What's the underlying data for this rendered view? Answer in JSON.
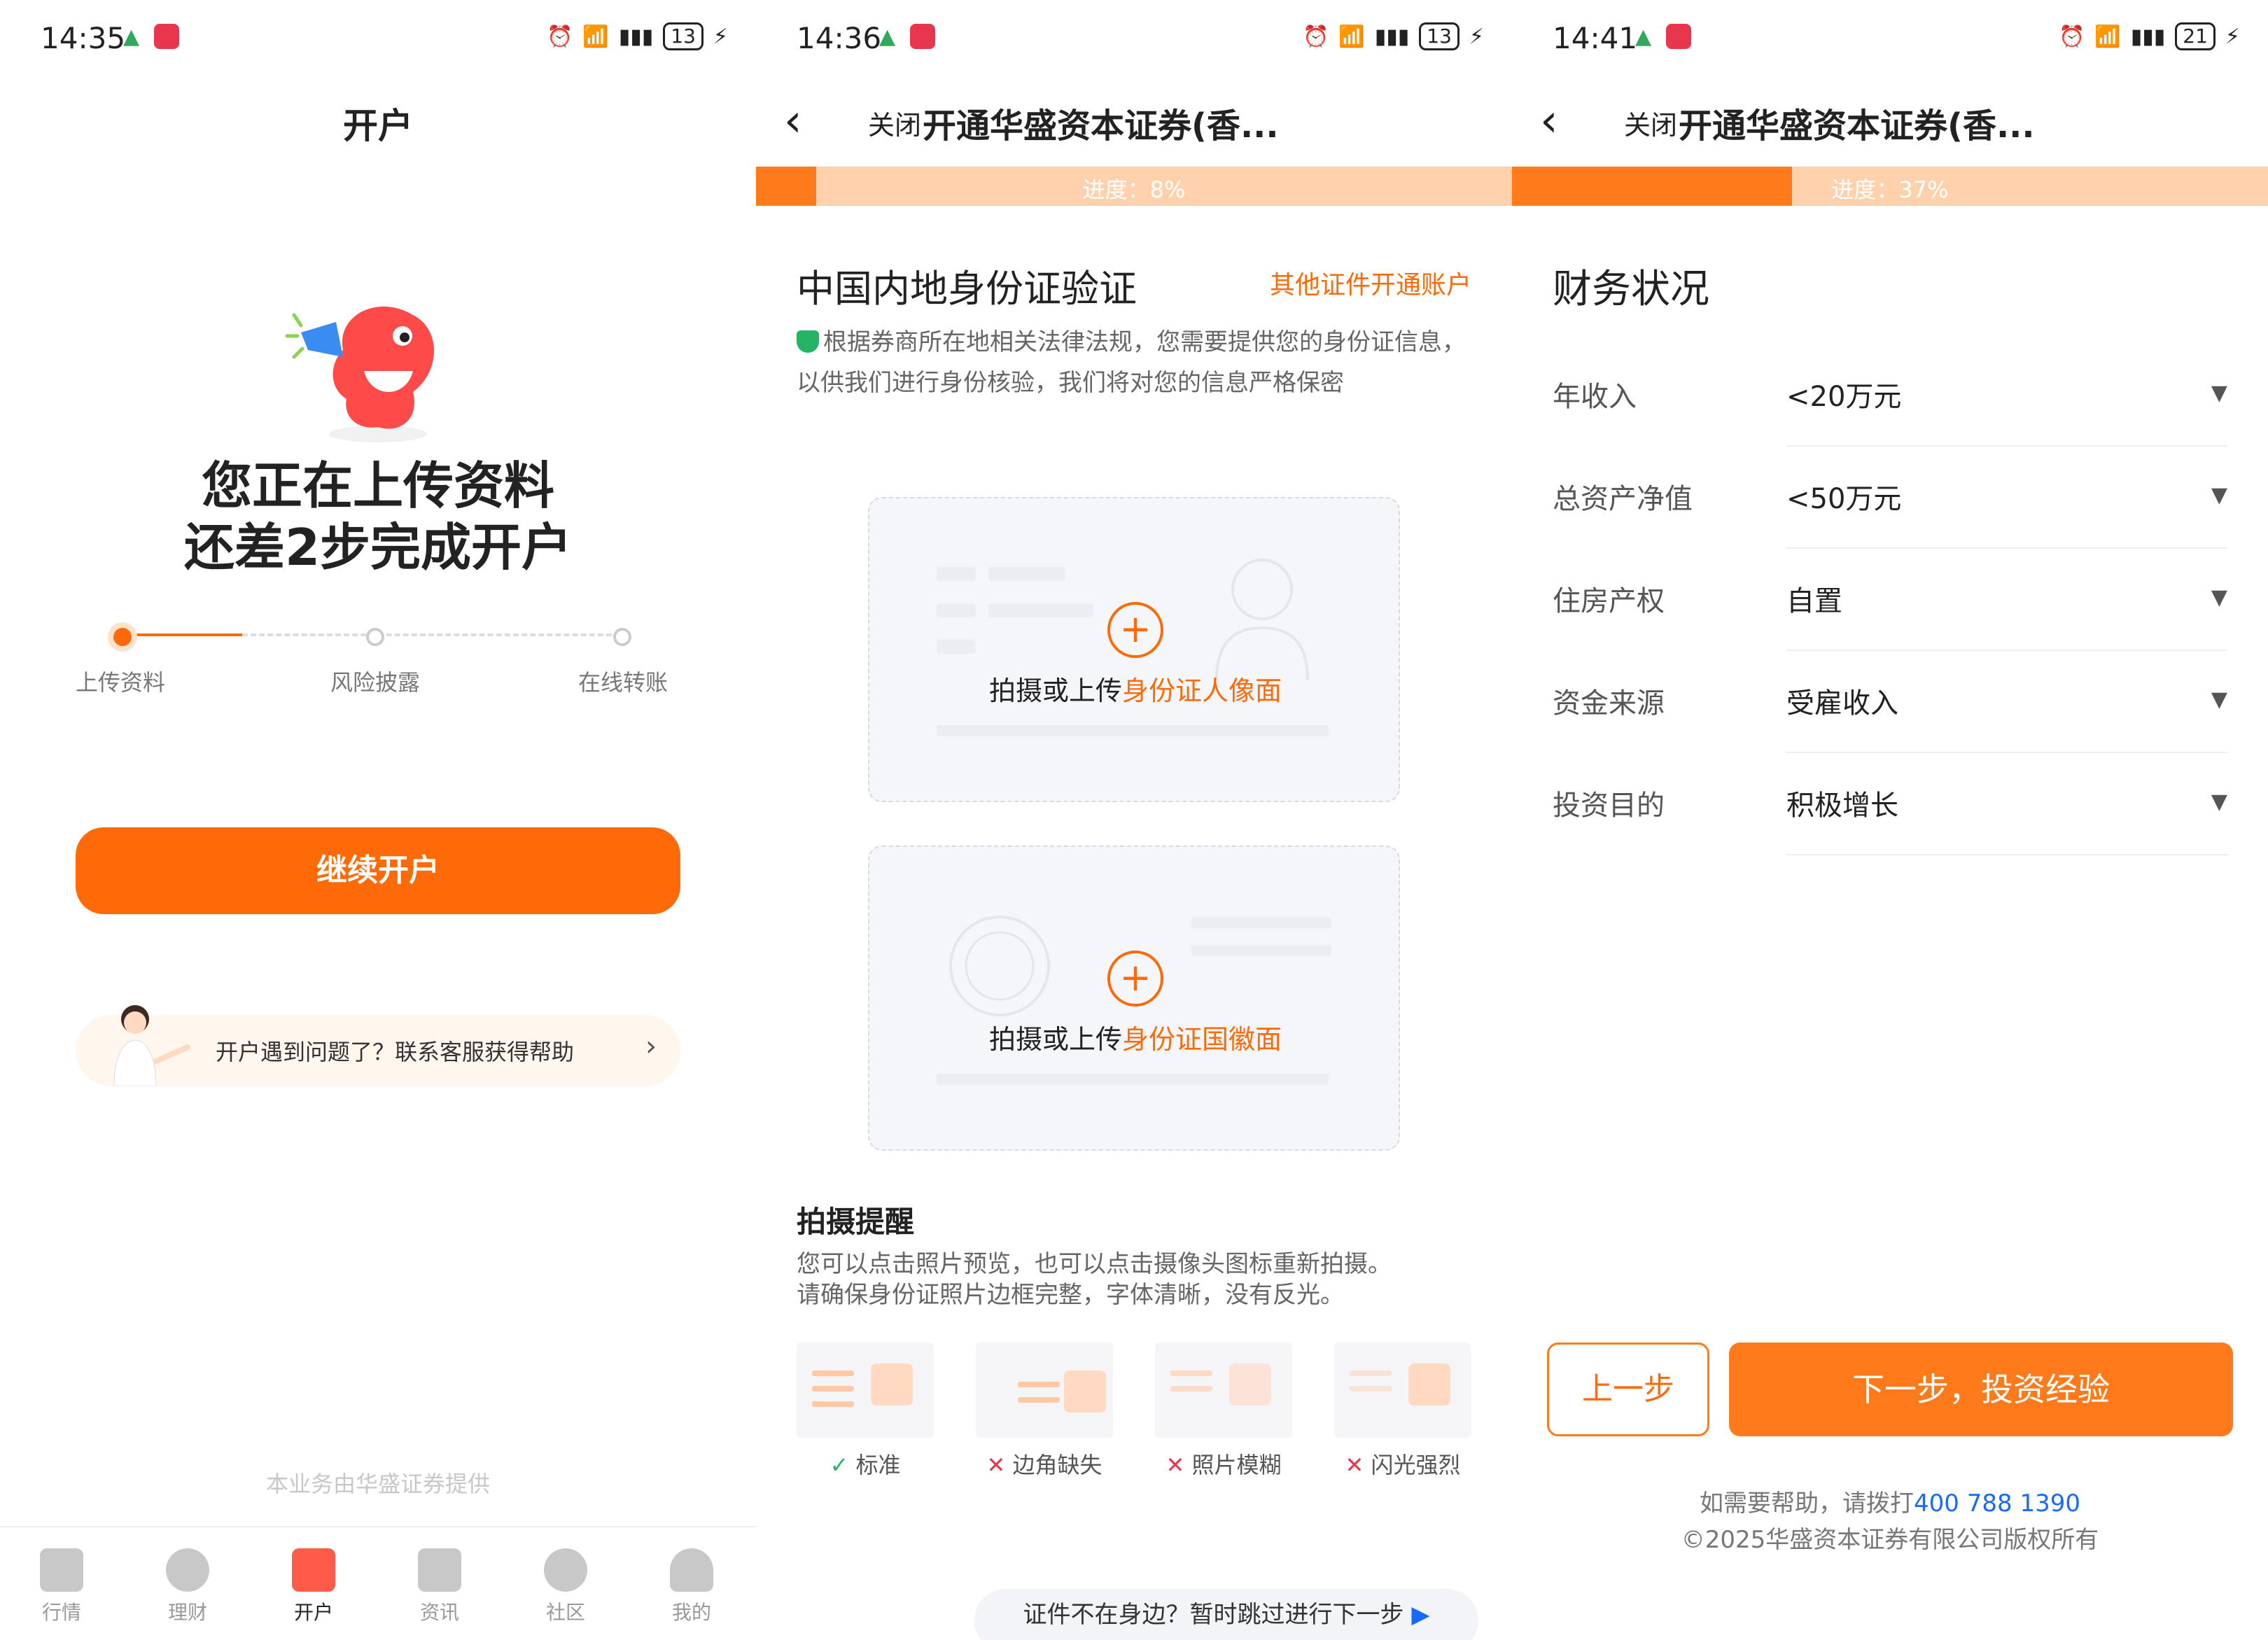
{
  "screen1": {
    "status": {
      "time": "14:35",
      "battery": "13"
    },
    "title": "开户",
    "headline_line1": "您正在上传资料",
    "headline_line2": "还差2步完成开户",
    "steps": [
      "上传资料",
      "风险披露",
      "在线转账"
    ],
    "progress_step": 1,
    "continue_button": "继续开户",
    "help_text": "开户遇到问题了？联系客服获得帮助",
    "provided_by": "本业务由华盛证券提供",
    "tabs": [
      {
        "label": "行情",
        "icon": "chart-icon"
      },
      {
        "label": "理财",
        "icon": "diamond-icon"
      },
      {
        "label": "开户",
        "icon": "gift-icon"
      },
      {
        "label": "资讯",
        "icon": "news-icon"
      },
      {
        "label": "社区",
        "icon": "refresh-icon"
      },
      {
        "label": "我的",
        "icon": "profile-icon"
      }
    ],
    "active_tab": "开户"
  },
  "screen2": {
    "status": {
      "time": "14:36",
      "battery": "13"
    },
    "close": "关闭",
    "title": "开通华盛资本证券(香...",
    "progress_label": "进度：8%",
    "progress_value": 0.08,
    "section_title": "中国内地身份证验证",
    "other_link": "其他证件开通账户",
    "note": "根据券商所在地相关法律法规，您需要提供您的身份证信息，以供我们进行身份核验，我们将对您的信息严格保密",
    "card1_prefix": "拍摄或上传",
    "card1_highlight": "身份证人像面",
    "card2_prefix": "拍摄或上传",
    "card2_highlight": "身份证国徽面",
    "tips_title": "拍摄提醒",
    "tips_line1": "您可以点击照片预览，也可以点击摄像头图标重新拍摄。",
    "tips_line2": "请确保身份证照片边框完整，字体清晰，没有反光。",
    "examples": [
      {
        "label": "标准",
        "status": "ok"
      },
      {
        "label": "边角缺失",
        "status": "bad"
      },
      {
        "label": "照片模糊",
        "status": "bad"
      },
      {
        "label": "闪光强烈",
        "status": "bad"
      }
    ],
    "skip_text": "证件不在身边？暂时跳过进行下一步"
  },
  "screen3": {
    "status": {
      "time": "14:41",
      "battery": "21"
    },
    "close": "关闭",
    "title": "开通华盛资本证券(香...",
    "progress_label": "进度：37%",
    "progress_value": 0.37,
    "section_title": "财务状况",
    "fields": [
      {
        "label": "年收入",
        "value": "<20万元"
      },
      {
        "label": "总资产净值",
        "value": "<50万元"
      },
      {
        "label": "住房产权",
        "value": "自置"
      },
      {
        "label": "资金来源",
        "value": "受雇收入"
      },
      {
        "label": "投资目的",
        "value": "积极增长"
      }
    ],
    "prev_button": "上一步",
    "next_button": "下一步，投资经验",
    "help_prefix": "如需要帮助，请拨打",
    "help_phone": "400 788 1390",
    "copyright": "©2025华盛资本证券有限公司版权所有"
  },
  "colors": {
    "accent": "#ff6a09",
    "progress_fill": "#ff7a1a",
    "progress_track": "#ffd2ad",
    "link_blue": "#1769ff",
    "ok_green": "#25b465",
    "bad_red": "#e8374d"
  }
}
